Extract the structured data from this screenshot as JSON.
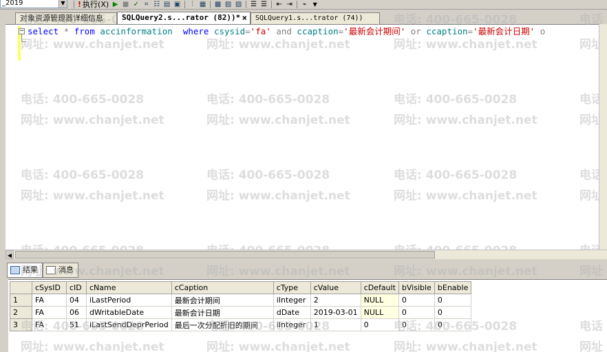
{
  "toolbar": {
    "database": "_2019",
    "execute_label": "执行(X)"
  },
  "tabs": [
    {
      "label": "对象资源管理器详细信息"
    },
    {
      "label": "SQLQuery2.s...rator (82))*"
    },
    {
      "label": "SQLQuery1.s...trator (74))"
    }
  ],
  "editor": {
    "kw_select": "select",
    "star": "*",
    "kw_from": "from",
    "table": "accinformation",
    "kw_where": "where",
    "col1": "csysid",
    "eq": "=",
    "val1": "'fa'",
    "kw_and": "and",
    "col2": "ccaption",
    "val2": "'最新会计期间'",
    "kw_or": "or",
    "col3": "ccaption",
    "val3": "'最新会计日期'",
    "trail": "o"
  },
  "watermark": {
    "phone": "电话: 400-665-0028",
    "site": "网址: www.chanjet.net",
    "phone_short": "电话",
    "site_short": "网址"
  },
  "results": {
    "tab_results": "结果",
    "tab_messages": "消息",
    "columns": [
      "cSysID",
      "cID",
      "cName",
      "cCaption",
      "cType",
      "cValue",
      "cDefault",
      "bVisible",
      "bEnable"
    ],
    "rows": [
      {
        "num": "1",
        "cSysID": "FA",
        "cID": "04",
        "cName": "iLastPeriod",
        "cCaption": "最新会计期间",
        "cType": "iInteger",
        "cValue": "2",
        "cDefault": "NULL",
        "bVisible": "0",
        "bEnable": "0"
      },
      {
        "num": "2",
        "cSysID": "FA",
        "cID": "06",
        "cName": "dWritableDate",
        "cCaption": "最新会计日期",
        "cType": "dDate",
        "cValue": "2019-03-01",
        "cDefault": "NULL",
        "bVisible": "0",
        "bEnable": "0"
      },
      {
        "num": "3",
        "cSysID": "FA",
        "cID": "51",
        "cName": "iLastSendDeprPeriod",
        "cCaption": "最后一次分配折旧的期间",
        "cType": "iInteger",
        "cValue": "1",
        "cDefault": "0",
        "bVisible": "0",
        "bEnable": "0"
      }
    ]
  }
}
